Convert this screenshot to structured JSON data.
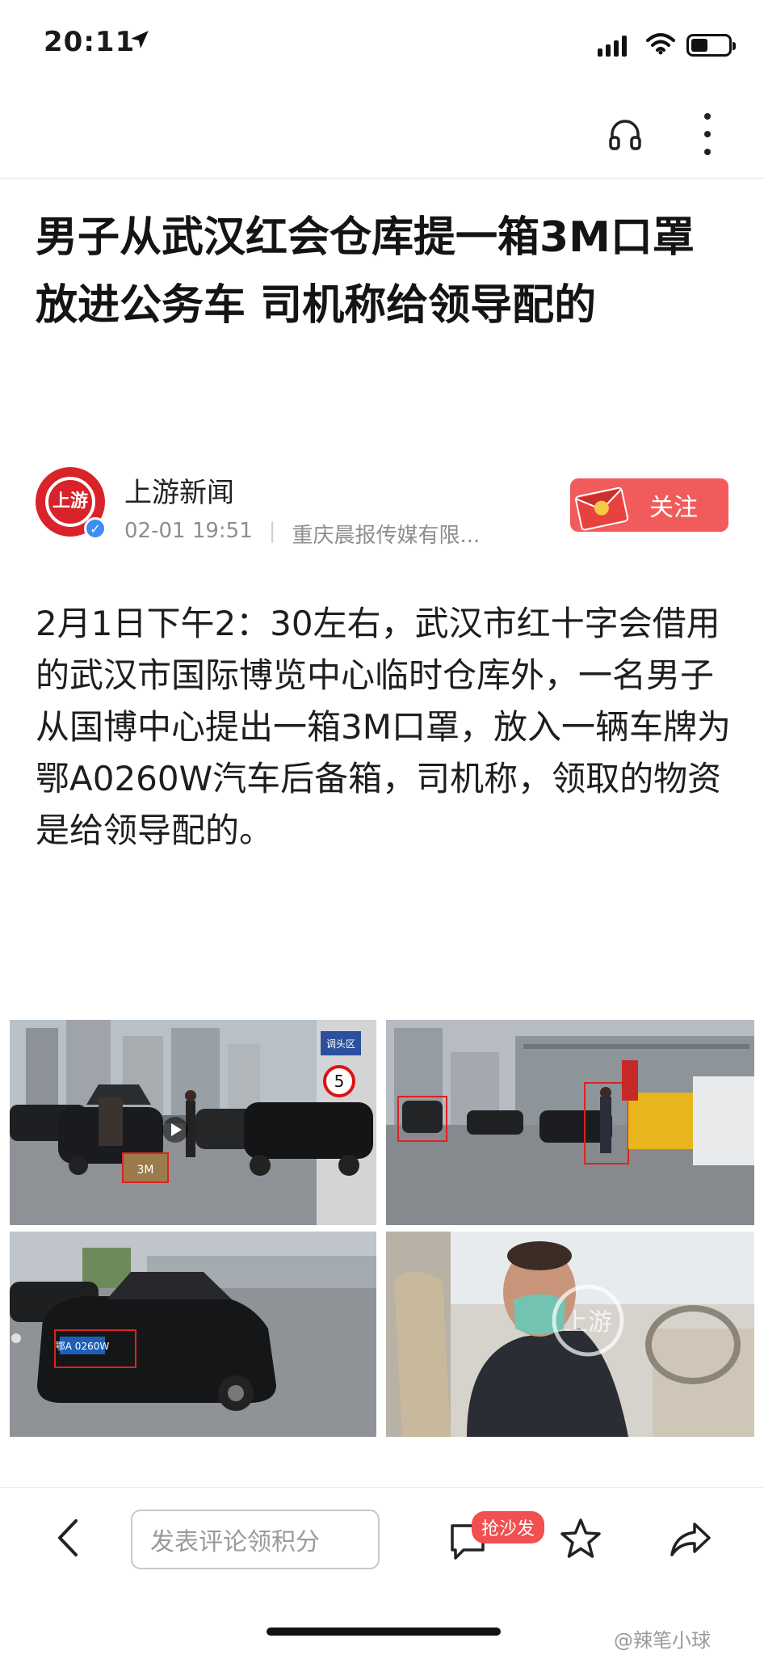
{
  "status_bar": {
    "time": "20:11"
  },
  "article": {
    "title": "男子从武汉红会仓库提一箱3M口罩放进公务车 司机称给领导配的",
    "author": {
      "avatar_text": "上游",
      "name": "上游新闻",
      "datetime": "02-01 19:51",
      "source": "重庆晨报传媒有限..."
    },
    "follow_label": "关注",
    "body": "2月1日下午2：30左右，武汉市红十字会借用的武汉市国际博览中心临时仓库外，一名男子从国博中心提出一箱3M口罩，放入一辆车牌为鄂A0260W汽车后备箱，司机称，领取的物资是给领导配的。",
    "photos": {
      "sign_label": "调头区",
      "speed_limit": "5",
      "box_label": "3M",
      "plate": "鄂A 0260W",
      "credit": "上游"
    }
  },
  "bottom_bar": {
    "comment_placeholder": "发表评论领积分",
    "sofa_badge": "抢沙发"
  },
  "watermark": "@辣笔小球",
  "colors": {
    "accent_red": "#f25b5b",
    "brand_red": "#d9232a",
    "verified_blue": "#3d8ef0"
  }
}
